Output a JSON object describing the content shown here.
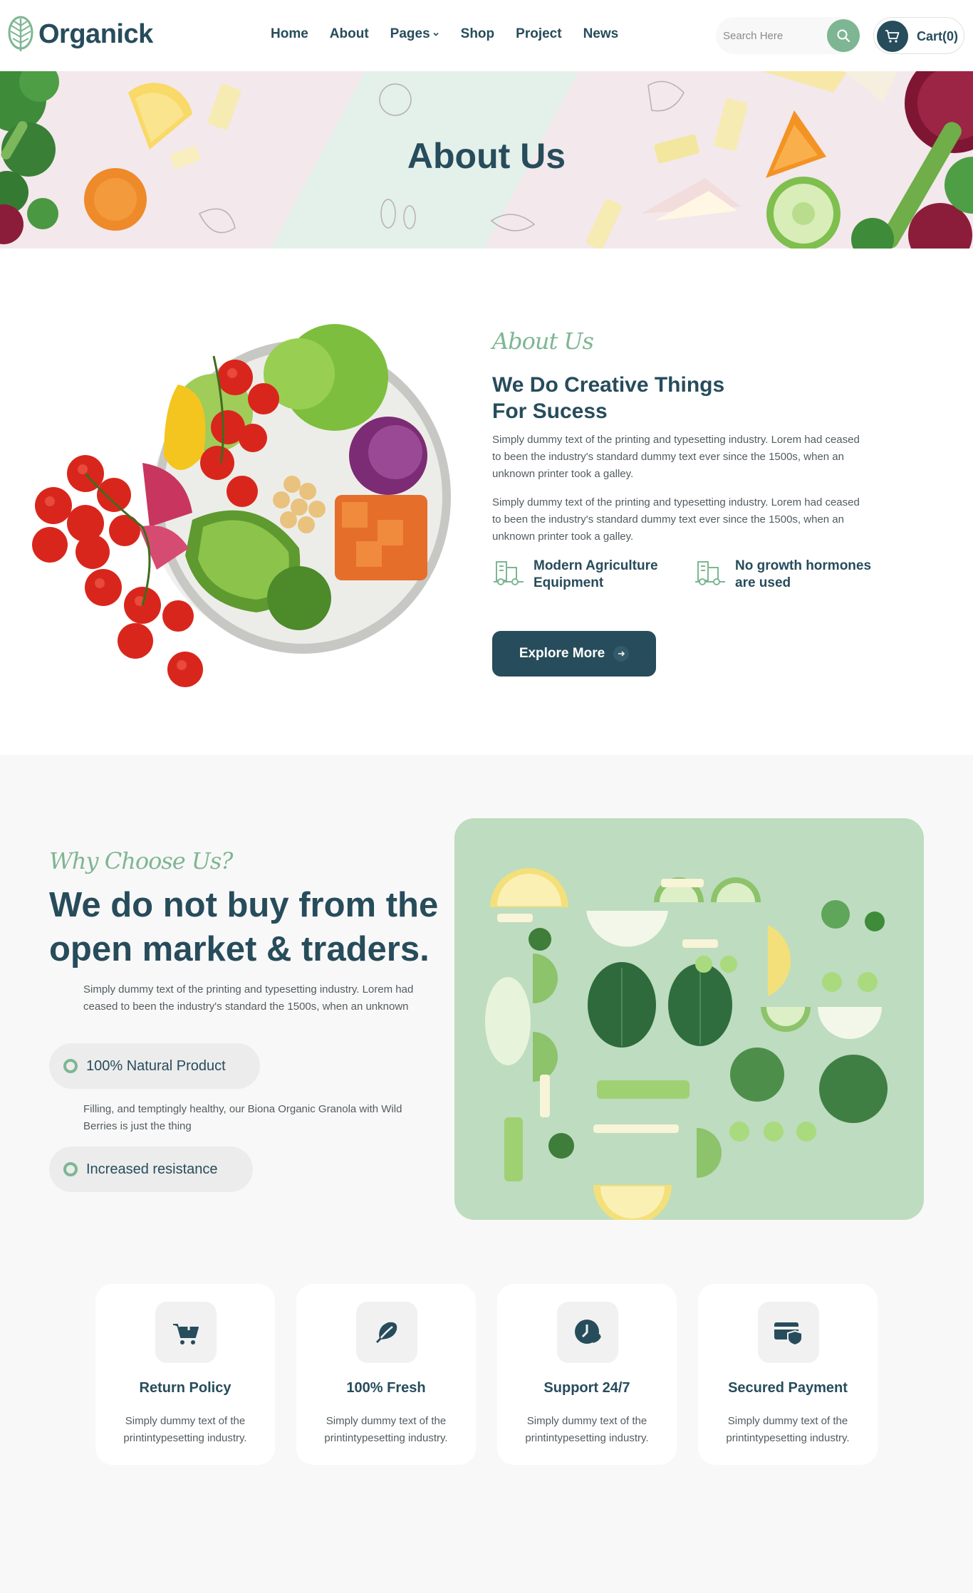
{
  "brand": {
    "name": "Organick"
  },
  "nav": {
    "items": [
      {
        "label": "Home"
      },
      {
        "label": "About"
      },
      {
        "label": "Pages"
      },
      {
        "label": "Shop"
      },
      {
        "label": "Project"
      },
      {
        "label": "News"
      }
    ],
    "search_placeholder": "Search Here",
    "cart_label": "Cart(0)"
  },
  "hero": {
    "title": "About Us"
  },
  "about": {
    "tag": "About Us",
    "heading": "We Do Creative Things For Sucess",
    "paragraph_1": "Simply dummy text of the printing and typesetting industry. Lorem had ceased to been the industry's standard dummy text ever since the 1500s, when an unknown printer took a galley.",
    "paragraph_2": "Simply dummy text of the printing and typesetting industry. Lorem had ceased to been the industry's standard dummy text ever since the 1500s, when an unknown printer took a galley.",
    "features": [
      {
        "label": "Modern Agriculture Equipment"
      },
      {
        "label": "No growth hormones are used"
      }
    ],
    "cta_label": "Explore More"
  },
  "why": {
    "tag": "Why Choose Us?",
    "heading": "We do not buy from the open market & traders.",
    "paragraph_1": "Simply dummy text of the printing and typesetting industry. Lorem had ceased to been the industry's standard the 1500s, when an unknown",
    "pill_1": "100% Natural Product",
    "paragraph_2": "Filling, and temptingly healthy, our Biona Organic Granola with Wild Berries is just the thing",
    "pill_2": "Increased resistance"
  },
  "cards": [
    {
      "title": "Return Policy",
      "text": "Simply dummy text of the printintypesetting industry.",
      "icon": "cart-return-icon"
    },
    {
      "title": "100% Fresh",
      "text": "Simply dummy text of the printintypesetting industry.",
      "icon": "leaf-icon"
    },
    {
      "title": "Support 24/7",
      "text": "Simply dummy text of the printintypesetting industry.",
      "icon": "support-clock-icon"
    },
    {
      "title": "Secured Payment",
      "text": "Simply dummy text of the printintypesetting industry.",
      "icon": "secure-card-icon"
    }
  ],
  "colors": {
    "primary": "#274C5B",
    "accent": "#7EB693",
    "hero_bg": "#F3E8EC",
    "section_bg": "#F9F8F8",
    "body_text": "#525C60"
  }
}
